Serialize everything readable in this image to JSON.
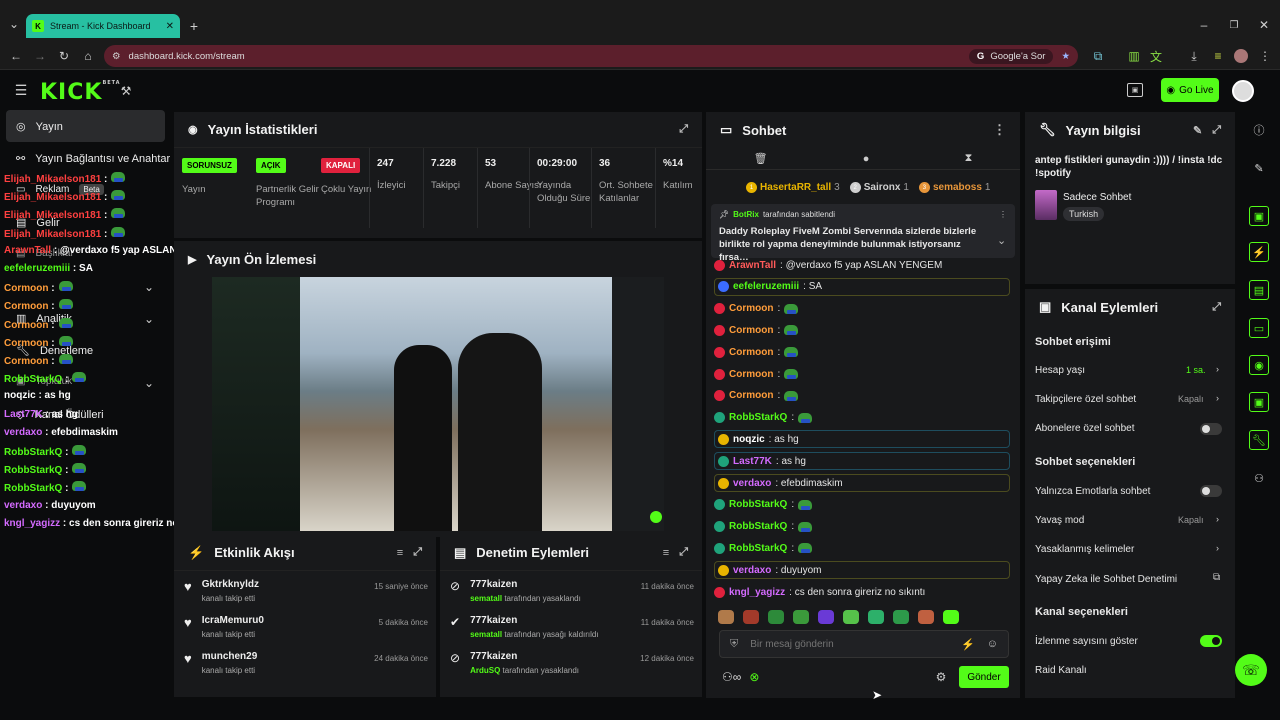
{
  "browser": {
    "tab_title": "Stream - Kick Dashboard",
    "url": "dashboard.kick.com/stream",
    "google_btn": "Google'a Sor"
  },
  "header": {
    "logo": "KICK",
    "logo_badge": "BETA",
    "go_live": "Go Live"
  },
  "sidebar": {
    "items": [
      {
        "label": "Yayın"
      },
      {
        "label": "Yayın Bağlantısı ve Anahtar"
      },
      {
        "label": "Reklam"
      },
      {
        "label": "Beta"
      },
      {
        "label": "Gelir"
      },
      {
        "label": "Başlıklar"
      },
      {
        "label": "Analitik"
      },
      {
        "label": "Denetleme"
      },
      {
        "label": "Topluluk"
      },
      {
        "label": "Kanal Ödülleri"
      }
    ]
  },
  "overlay_chat": [
    {
      "user": "Elijah_Mikaelson181",
      "text": ":",
      "color": "#ff4040"
    },
    {
      "user": "Elijah_Mikaelson181",
      "text": ":",
      "color": "#ff4040"
    },
    {
      "user": "Elijah_Mikaelson181",
      "text": ":",
      "color": "#ff4040"
    },
    {
      "user": "Elijah_Mikaelson181",
      "text": ":",
      "color": "#ff4040"
    },
    {
      "user": "ArawnTall",
      "text": ": @verdaxo f5 yap ASLAN YENGEM",
      "color": "#ff4040"
    },
    {
      "user": "eefeleruzemiii",
      "text": ": SA",
      "color": "#53fc18"
    },
    {
      "user": "Cormoon",
      "text": ":",
      "color": "#ff9d3b"
    },
    {
      "user": "Cormoon",
      "text": ":",
      "color": "#ff9d3b"
    },
    {
      "user": "Cormoon",
      "text": ":",
      "color": "#ff9d3b"
    },
    {
      "user": "Cormoon",
      "text": ":",
      "color": "#ff9d3b"
    },
    {
      "user": "Cormoon",
      "text": ":",
      "color": "#ff9d3b"
    },
    {
      "user": "RobbStarkQ",
      "text": ":",
      "color": "#53fc18"
    },
    {
      "user": "noqzic",
      "text": ": as hg",
      "color": "#ffffff"
    },
    {
      "user": "Last77K",
      "text": ": as hg",
      "color": "#d46bff"
    },
    {
      "user": "verdaxo",
      "text": ": efebdimaskim",
      "color": "#d46bff"
    },
    {
      "user": "RobbStarkQ",
      "text": ":",
      "color": "#53fc18"
    },
    {
      "user": "RobbStarkQ",
      "text": ":",
      "color": "#53fc18"
    },
    {
      "user": "RobbStarkQ",
      "text": ":",
      "color": "#53fc18"
    },
    {
      "user": "verdaxo",
      "text": ": duyuyom",
      "color": "#d46bff"
    },
    {
      "user": "kngl_yagizz",
      "text": ": cs den sonra gireriz no sıkıntı",
      "color": "#d46bff"
    }
  ],
  "stats_panel": {
    "title": "Yayın İstatistikleri",
    "cells": [
      {
        "value": "SORUNSUZ",
        "label": "Yayın",
        "pill": true,
        "pill_bg": "#53fc18",
        "pill_fg": "#000"
      },
      {
        "value": "AÇIK",
        "label": "Partnerlik Gelir Programı",
        "pill": true,
        "pill_bg": "#53fc18",
        "pill_fg": "#000"
      },
      {
        "value": "KAPALI",
        "label": "Çoklu Yayın",
        "pill": true,
        "pill_bg": "#e0213d",
        "pill_fg": "#fff"
      },
      {
        "value": "247",
        "label": "İzleyici",
        "pill": false
      },
      {
        "value": "7.228",
        "label": "Takipçi",
        "pill": false
      },
      {
        "value": "53",
        "label": "Abone Sayısı",
        "pill": false
      },
      {
        "value": "00:29:00",
        "label": "Yayında Olduğu Süre",
        "pill": false
      },
      {
        "value": "36",
        "label": "Ort. Sohbete Katılanlar",
        "pill": false
      },
      {
        "value": "%14",
        "label": "Katılım",
        "pill": false
      }
    ]
  },
  "preview_panel": {
    "title": "Yayın Ön İzlemesi"
  },
  "activity_feed": {
    "title": "Etkinlik Akışı",
    "rows": [
      {
        "name": "Gktrkknyldz",
        "action": "kanalı takip etti",
        "time": "15 saniye önce"
      },
      {
        "name": "IcraMemuru0",
        "action": "kanalı takip etti",
        "time": "5 dakika önce"
      },
      {
        "name": "munchen29",
        "action": "kanalı takip etti",
        "time": "24 dakika önce"
      }
    ]
  },
  "mod_actions": {
    "title": "Denetim Eylemleri",
    "rows": [
      {
        "name": "777kaizen",
        "mod": "sematall",
        "action": "tarafından yasaklandı",
        "time": "11 dakika önce"
      },
      {
        "name": "777kaizen",
        "mod": "sematall",
        "action": "tarafından yasağı kaldırıldı",
        "time": "11 dakika önce"
      },
      {
        "name": "777kaizen",
        "mod": "ArduSQ",
        "action": "tarafından yasaklandı",
        "time": "12 dakika önce"
      }
    ]
  },
  "chat": {
    "title": "Sohbet",
    "top_gifters": [
      {
        "name": "HasertaRR_tall",
        "count": "3"
      },
      {
        "name": "Saironx",
        "count": "1"
      },
      {
        "name": "semaboss",
        "count": "1"
      }
    ],
    "pinned_by": "BotRix",
    "pinned_suffix": "tarafından sabitlendi",
    "pinned_text": "Daddy Roleplay FiveM Zombi Serverında sizlerde bizlerle birlikte rol yapma deneyiminde bulunmak istiyorsanız fırsa…",
    "messages": [
      {
        "user": "ArawnTall",
        "text": ": @verdaxo f5 yap ASLAN YENGEM",
        "color": "#ff5a5a",
        "badge": "#e0213d",
        "box": false
      },
      {
        "user": "eefeleruzemiii",
        "text": ": SA",
        "color": "#53fc18",
        "badge": "#3b6cff",
        "box": true
      },
      {
        "user": "Cormoon",
        "text": ":",
        "color": "#ff9d3b",
        "badge": "#e0213d",
        "box": false,
        "emote": true
      },
      {
        "user": "Cormoon",
        "text": ":",
        "color": "#ff9d3b",
        "badge": "#e0213d",
        "box": false,
        "emote": true
      },
      {
        "user": "Cormoon",
        "text": ":",
        "color": "#ff9d3b",
        "badge": "#e0213d",
        "box": false,
        "emote": true
      },
      {
        "user": "Cormoon",
        "text": ":",
        "color": "#ff9d3b",
        "badge": "#e0213d",
        "box": false,
        "emote": true
      },
      {
        "user": "Cormoon",
        "text": ":",
        "color": "#ff9d3b",
        "badge": "#e0213d",
        "box": false,
        "emote": true
      },
      {
        "user": "RobbStarkQ",
        "text": ":",
        "color": "#53fc18",
        "badge": "#1fa37b",
        "box": false,
        "emote": true
      },
      {
        "user": "noqzic",
        "text": ": as hg",
        "color": "#ffffff",
        "badge": "#e8b400",
        "box": true
      },
      {
        "user": "Last77K",
        "text": ": as hg",
        "color": "#d46bff",
        "badge": "#1fa37b",
        "box": true
      },
      {
        "user": "verdaxo",
        "text": ": efebdimaskim",
        "color": "#d46bff",
        "badge": "#e8b400",
        "box": true
      },
      {
        "user": "RobbStarkQ",
        "text": ":",
        "color": "#53fc18",
        "badge": "#1fa37b",
        "box": false,
        "emote": true
      },
      {
        "user": "RobbStarkQ",
        "text": ":",
        "color": "#53fc18",
        "badge": "#1fa37b",
        "box": false,
        "emote": true
      },
      {
        "user": "RobbStarkQ",
        "text": ":",
        "color": "#53fc18",
        "badge": "#1fa37b",
        "box": false,
        "emote": true
      },
      {
        "user": "verdaxo",
        "text": ": duyuyom",
        "color": "#d46bff",
        "badge": "#e8b400",
        "box": true
      },
      {
        "user": "kngl_yagizz",
        "text": ": cs den sonra gireriz no sıkıntı",
        "color": "#d46bff",
        "badge": "#e0213d",
        "box": false
      }
    ],
    "input_placeholder": "Bir mesaj gönderin",
    "send": "Gönder"
  },
  "stream_info": {
    "title": "Yayın bilgisi",
    "stream_title": "antep fistikleri gunaydin :)))) / !insta !dc !spotify",
    "category": "Sadece Sohbet",
    "tag": "Turkish"
  },
  "channel_actions": {
    "title": "Kanal Eylemleri",
    "section_access": "Sohbet erişimi",
    "account_age_label": "Hesap yaşı",
    "account_age_value": "1 sa.",
    "followers_only_label": "Takipçilere özel sohbet",
    "followers_only_value": "Kapalı",
    "subs_only_label": "Abonelere özel sohbet",
    "section_options": "Sohbet seçenekleri",
    "emote_only_label": "Yalnızca Emotlarla sohbet",
    "slow_mode_label": "Yavaş mod",
    "slow_mode_value": "Kapalı",
    "banned_words_label": "Yasaklanmış kelimeler",
    "ai_mod_label": "Yapay Zeka ile Sohbet Denetimi",
    "section_channel": "Kanal seçenekleri",
    "show_viewers_label": "İzlenme sayısını göster",
    "raid_label": "Raid Kanalı"
  },
  "colors": {
    "accent": "#53fc18",
    "danger": "#e0213d",
    "panel": "#18191b",
    "page": "#0b0c0d"
  }
}
